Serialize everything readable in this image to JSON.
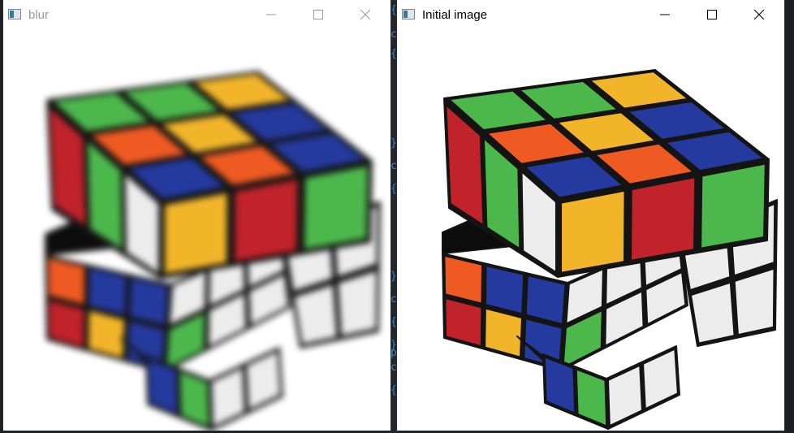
{
  "windows": [
    {
      "id": "blur",
      "title": "blur",
      "active": false,
      "controls": {
        "minimize": "minimize-icon",
        "maximize": "maximize-icon",
        "close": "close-icon"
      },
      "image_subject": "rubiks-cube"
    },
    {
      "id": "initial",
      "title": "Initial image",
      "active": true,
      "controls": {
        "minimize": "minimize-icon",
        "maximize": "maximize-icon",
        "close": "close-icon"
      },
      "image_subject": "rubiks-cube"
    }
  ],
  "colors": {
    "green": "#4cb84c",
    "yellow": "#f2b52a",
    "blue": "#243a9e",
    "red": "#c0232a",
    "orange": "#ef5a22",
    "white": "#ececec",
    "edge": "#141414",
    "background": "#1e1f22",
    "title_inactive": "#9a9a9a",
    "title_active": "#000000"
  },
  "background_strip": [
    "{",
    "c",
    "{",
    "}",
    "c",
    "{",
    "}",
    "c",
    "{",
    "}",
    "c",
    "{",
    "p"
  ]
}
